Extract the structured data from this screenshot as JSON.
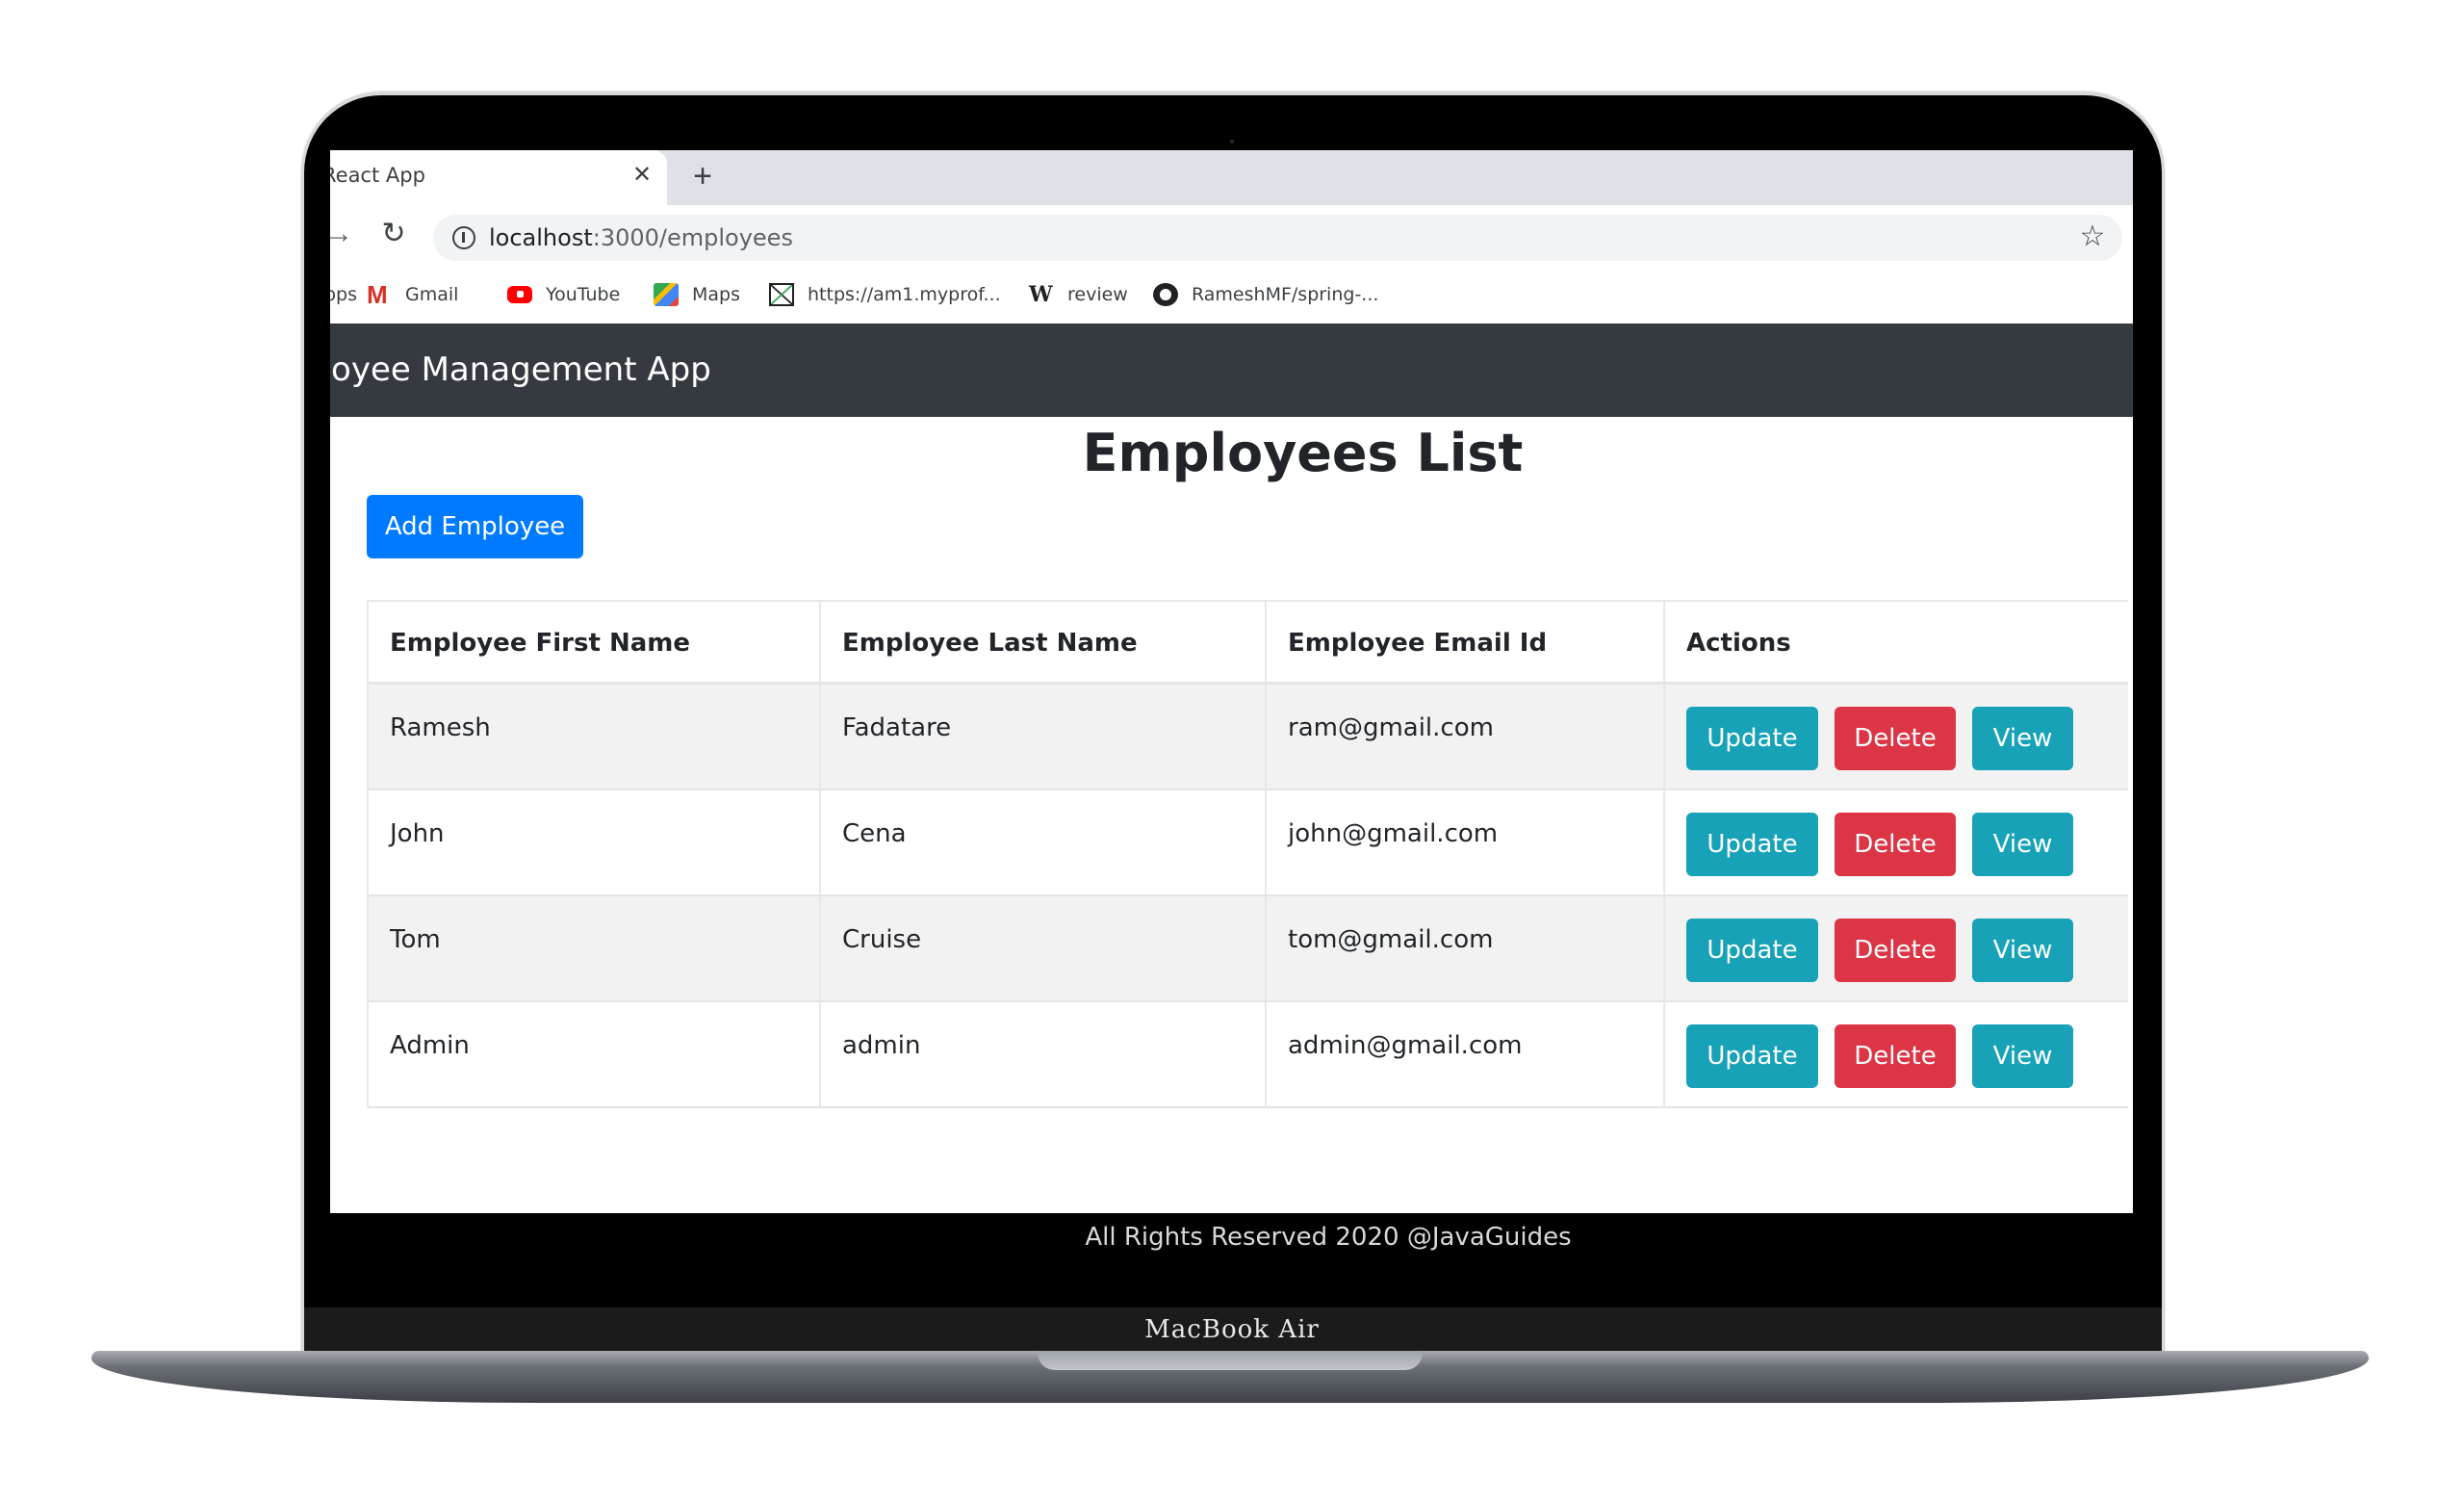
{
  "browser": {
    "tab": {
      "title": "React App",
      "close_icon": "close-icon"
    },
    "new_tab_icon": "plus-icon",
    "forward_icon": "arrow-right-icon",
    "reload_icon": "reload-icon",
    "address": {
      "host": "localhost",
      "path": ":3000/employees",
      "info_icon": "info-icon"
    },
    "bookmark_star_icon": "star-icon",
    "bookmarks": [
      {
        "label": "pps",
        "icon": "apps-icon"
      },
      {
        "label": "Gmail",
        "icon": "gmail-icon"
      },
      {
        "label": "YouTube",
        "icon": "youtube-icon"
      },
      {
        "label": "Maps",
        "icon": "maps-icon"
      },
      {
        "label": "https://am1.myprof...",
        "icon": "mail-icon"
      },
      {
        "label": "review",
        "icon": "wikipedia-icon"
      },
      {
        "label": "RameshMF/spring-...",
        "icon": "github-icon"
      }
    ]
  },
  "app": {
    "brand": "ployee Management App",
    "page_title": "Employees List",
    "add_button": "Add Employee",
    "colors": {
      "navbar": "#343a40",
      "primary": "#007bff",
      "info": "#17a2b8",
      "danger": "#dc3545"
    },
    "table": {
      "headers": [
        "Employee First Name",
        "Employee Last Name",
        "Employee Email Id",
        "Actions"
      ],
      "rows": [
        {
          "first": "Ramesh",
          "last": "Fadatare",
          "email": "ram@gmail.com"
        },
        {
          "first": "John",
          "last": "Cena",
          "email": "john@gmail.com"
        },
        {
          "first": "Tom",
          "last": "Cruise",
          "email": "tom@gmail.com"
        },
        {
          "first": "Admin",
          "last": "admin",
          "email": "admin@gmail.com"
        }
      ],
      "actions": {
        "update": "Update",
        "delete": "Delete",
        "view": "View"
      }
    },
    "footer": "All Rights Reserved 2020 @JavaGuides"
  },
  "device": {
    "label": "MacBook Air"
  }
}
